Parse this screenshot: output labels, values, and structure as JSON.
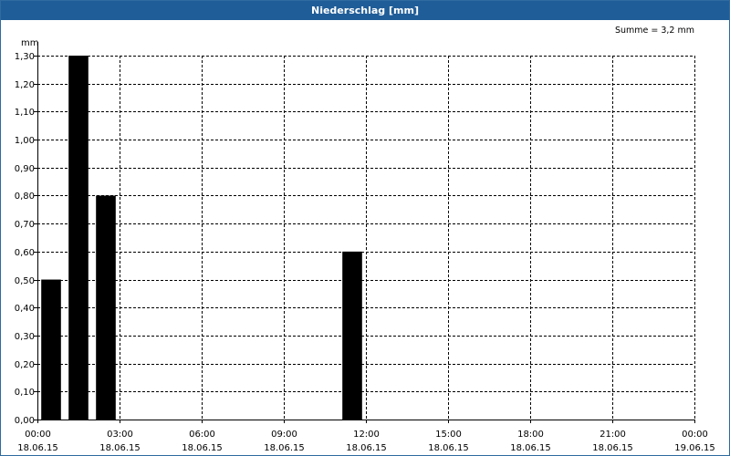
{
  "window": {
    "title": "Niederschlag [mm]"
  },
  "chart_data": {
    "type": "bar",
    "title": "Niederschlag [mm]",
    "ylabel": "mm",
    "annotation": "Summe = 3,2 mm",
    "ylim": [
      0,
      1.3
    ],
    "yticks": [
      "0,00",
      "0,10",
      "0,20",
      "0,30",
      "0,40",
      "0,50",
      "0,60",
      "0,70",
      "0,80",
      "0,90",
      "1,00",
      "1,10",
      "1,20",
      "1,30"
    ],
    "xlim_hours": [
      0,
      24
    ],
    "xticks": [
      {
        "time": "00:00",
        "date": "18.06.15"
      },
      {
        "time": "03:00",
        "date": "18.06.15"
      },
      {
        "time": "06:00",
        "date": "18.06.15"
      },
      {
        "time": "09:00",
        "date": "18.06.15"
      },
      {
        "time": "12:00",
        "date": "18.06.15"
      },
      {
        "time": "15:00",
        "date": "18.06.15"
      },
      {
        "time": "18:00",
        "date": "18.06.15"
      },
      {
        "time": "21:00",
        "date": "18.06.15"
      },
      {
        "time": "00:00",
        "date": "19.06.15"
      }
    ],
    "bars": [
      {
        "start": "00:00",
        "end": "01:00",
        "value": 0.5
      },
      {
        "start": "01:00",
        "end": "02:00",
        "value": 1.3
      },
      {
        "start": "02:00",
        "end": "03:00",
        "value": 0.8
      },
      {
        "start": "11:00",
        "end": "12:00",
        "value": 0.6
      }
    ],
    "bar_color": "#000000",
    "grid": true
  }
}
